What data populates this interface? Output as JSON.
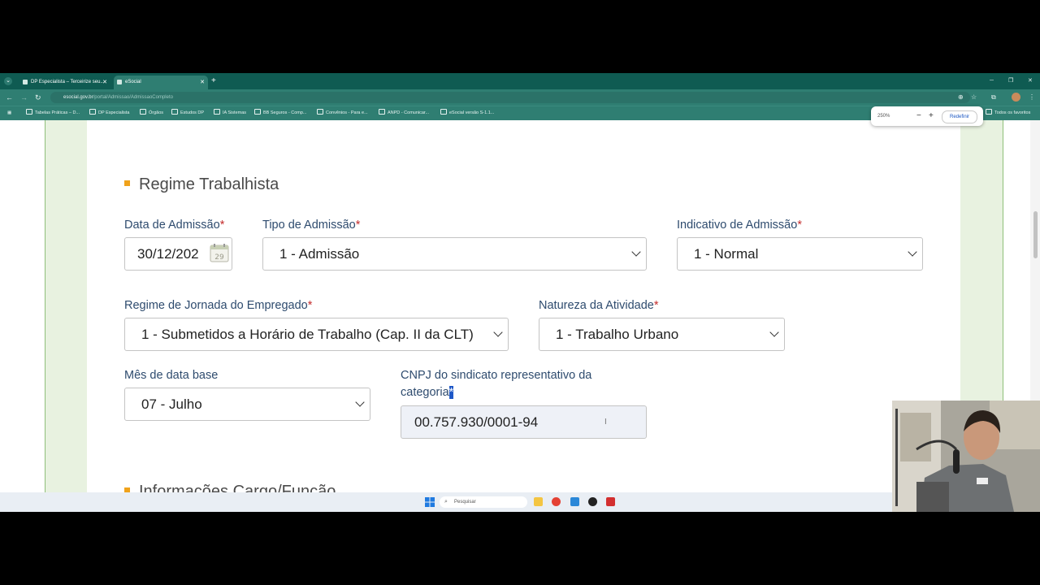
{
  "browser": {
    "tabs": [
      {
        "label": "DP Especialista – Terceirize seu..."
      },
      {
        "label": "eSocial"
      }
    ],
    "url": {
      "host": "esocial.gov.br",
      "path": "/portal/Admissao/AdmissaoCompleto"
    },
    "bookmarks": [
      "Tabelas Práticas – D...",
      "DP Especialista",
      "Órgãos",
      "Estudos DP",
      "IA Sistemas",
      "BB Seguros - Comp...",
      "Convênios - Para e...",
      "ANPD - Comunicar...",
      "eSocial versão S-1.1..."
    ],
    "all_bookmarks": "Todos os favoritos",
    "zoom": {
      "percent": "250%",
      "minus": "−",
      "plus": "+",
      "reset": "Redefinir"
    }
  },
  "form": {
    "section_title": "Regime Trabalhista",
    "next_section_title": "Informações Cargo/Função",
    "required_mark": "*",
    "data_admissao": {
      "label": "Data de Admissão",
      "value": "30/12/202",
      "calendar_day": "29"
    },
    "tipo_admissao": {
      "label": "Tipo de Admissão",
      "value": "1 - Admissão"
    },
    "indicativo_admissao": {
      "label": "Indicativo de Admissão",
      "value": "1 - Normal"
    },
    "regime_jornada": {
      "label": "Regime de Jornada do Empregado",
      "value": "1 - Submetidos a Horário de Trabalho (Cap. II da CLT)"
    },
    "natureza_atividade": {
      "label": "Natureza da Atividade",
      "value": "1 - Trabalho Urbano"
    },
    "mes_data_base": {
      "label": "Mês de data base",
      "value": "07 - Julho"
    },
    "cnpj_sindicato": {
      "label_line1": "CNPJ do sindicato representativo da",
      "label_line2": "categoria",
      "value": "00.757.930/0001-94"
    }
  },
  "taskbar": {
    "search_placeholder": "Pesquisar"
  }
}
